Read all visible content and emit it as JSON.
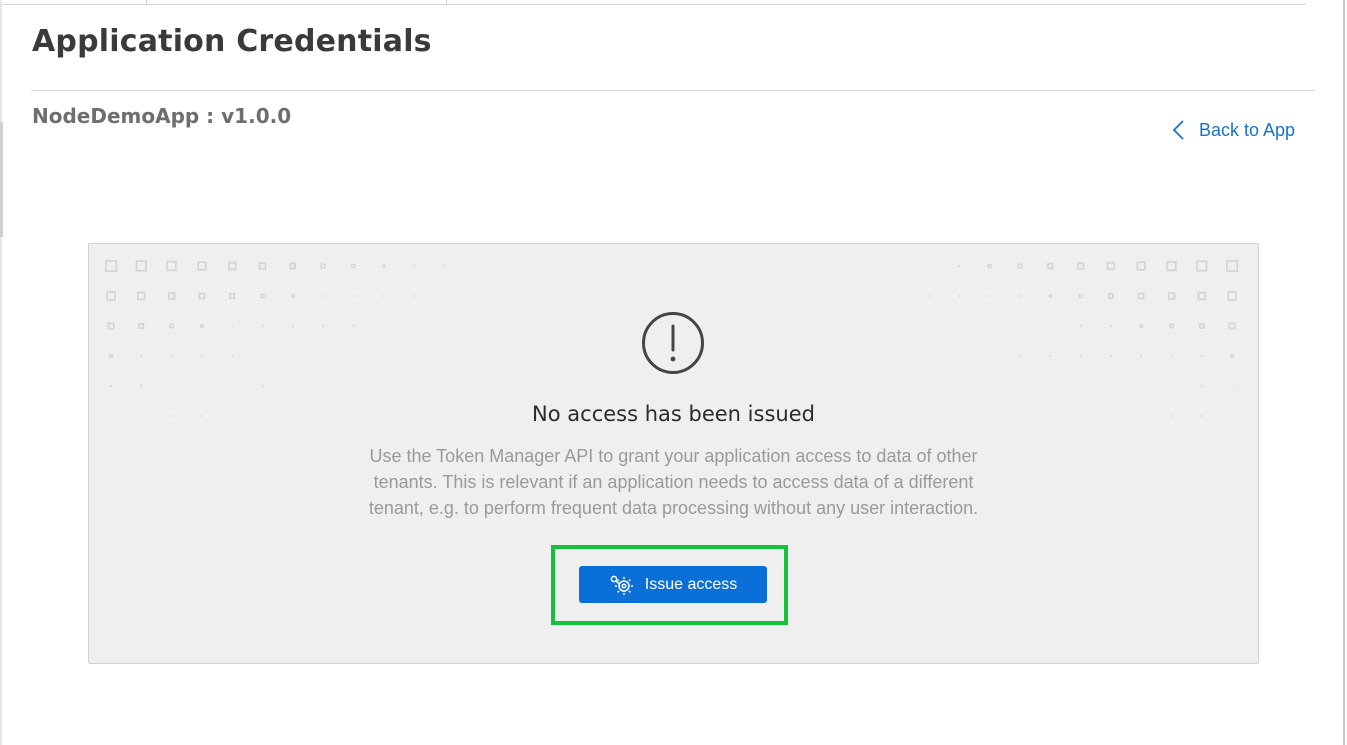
{
  "header": {
    "title": "Application Credentials",
    "app_name": "NodeDemoApp : v1.0.0",
    "back_link_label": "Back to App"
  },
  "empty_state": {
    "icon": "exclamation-circle-icon",
    "heading": "No access has been issued",
    "description": "Use the Token Manager API to grant your application access to data of other tenants. This is relevant if an application needs to access data of a different tenant, e.g. to perform frequent data processing without any user interaction.",
    "button_label": "Issue access",
    "button_icon": "key-gear-icon"
  },
  "colors": {
    "accent": "#0b6fd8",
    "link": "#1a73c8",
    "highlight": "#14c13a",
    "panel_bg": "#efefef"
  }
}
